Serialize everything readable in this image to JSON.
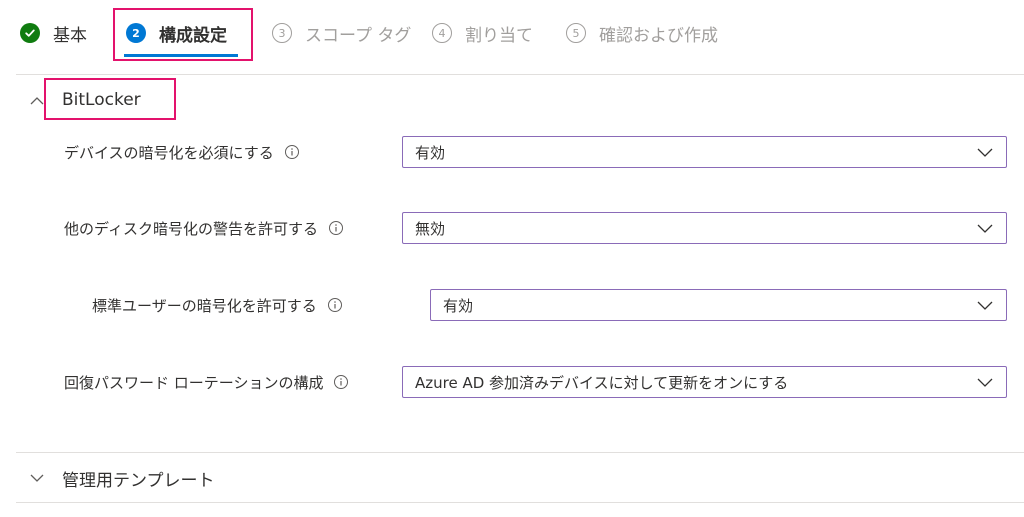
{
  "wizard": {
    "steps": [
      {
        "number": "",
        "label": "基本",
        "state": "done"
      },
      {
        "number": "2",
        "label": "構成設定",
        "state": "active"
      },
      {
        "number": "3",
        "label": "スコープ タグ",
        "state": "pending"
      },
      {
        "number": "4",
        "label": "割り当て",
        "state": "pending"
      },
      {
        "number": "5",
        "label": "確認および作成",
        "state": "pending"
      }
    ]
  },
  "sections": {
    "bitlocker": {
      "title": "BitLocker",
      "expanded": true,
      "settings": [
        {
          "label": "デバイスの暗号化を必須にする",
          "value": "有効"
        },
        {
          "label": "他のディスク暗号化の警告を許可する",
          "value": "無効"
        },
        {
          "label": "標準ユーザーの暗号化を許可する",
          "value": "有効"
        },
        {
          "label": "回復パスワード ローテーションの構成",
          "value": "Azure AD 参加済みデバイスに対して更新をオンにする"
        }
      ]
    },
    "admin_templates": {
      "title": "管理用テンプレート",
      "expanded": false
    }
  },
  "colors": {
    "accent": "#0078d4",
    "success": "#107c10",
    "highlight": "#e3126c",
    "dropdown_border": "#8a6bb8"
  },
  "icons": {
    "done": "checkmark-icon",
    "info": "info-icon",
    "dropdown": "chevron-down-icon",
    "collapse": "chevron-up-icon"
  }
}
